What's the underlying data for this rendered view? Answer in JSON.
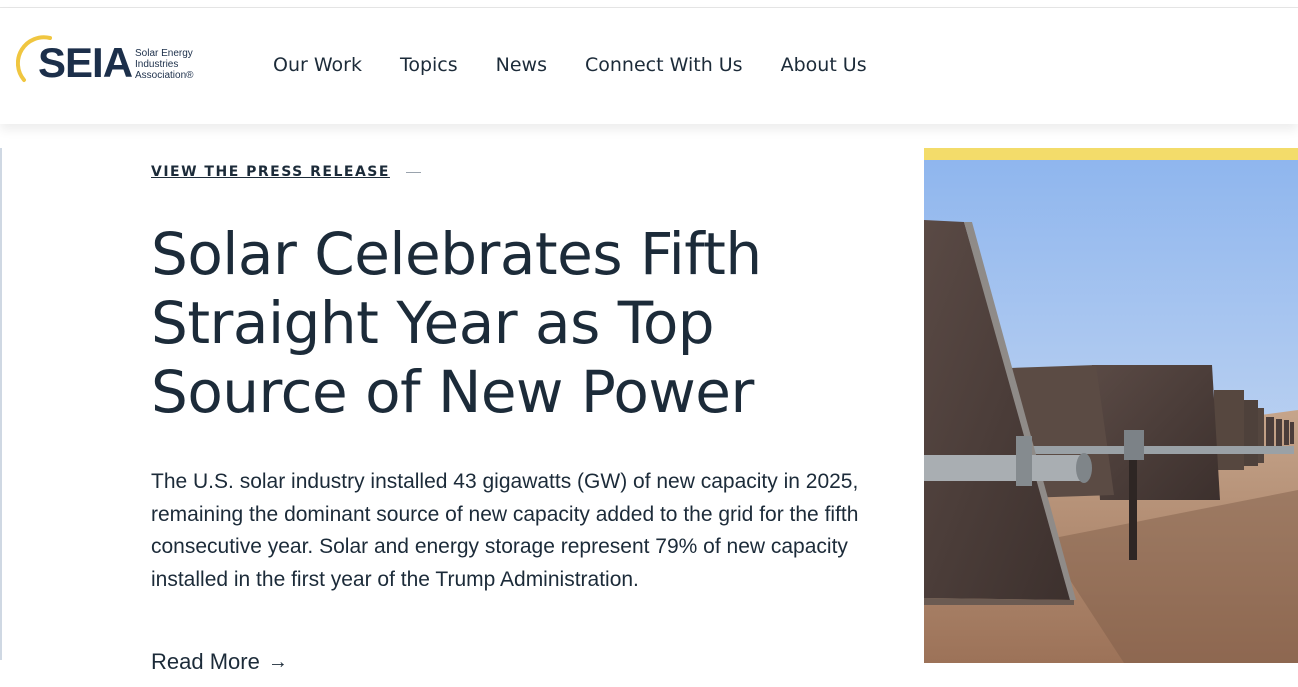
{
  "brand": {
    "logo_mark": "SEIA",
    "logo_lines": [
      "Solar Energy",
      "Industries",
      "Association®"
    ]
  },
  "nav": {
    "items": [
      "Our Work",
      "Topics",
      "News",
      "Connect With Us",
      "About Us"
    ]
  },
  "hero": {
    "eyebrow": "VIEW THE PRESS RELEASE",
    "headline_lines": [
      "Solar Celebrates Fifth",
      "Straight Year as Top",
      "Source of New Power"
    ],
    "summary": "The U.S. solar industry installed 43 gigawatts (GW) of new capacity in 2025, remaining the dominant source of new capacity added to the grid for the fifth consecutive year. Solar and energy storage represent 79% of new capacity installed in the first year of the Trump Administration.",
    "read_more": "Read More",
    "read_more_icon": "arrow-right-icon",
    "image": "solar-panel-array-photo"
  },
  "colors": {
    "text": "#1c2b39",
    "accent_yellow": "#f3dc6a",
    "sky": "#9dc0ef",
    "ground": "#b08a6e"
  }
}
